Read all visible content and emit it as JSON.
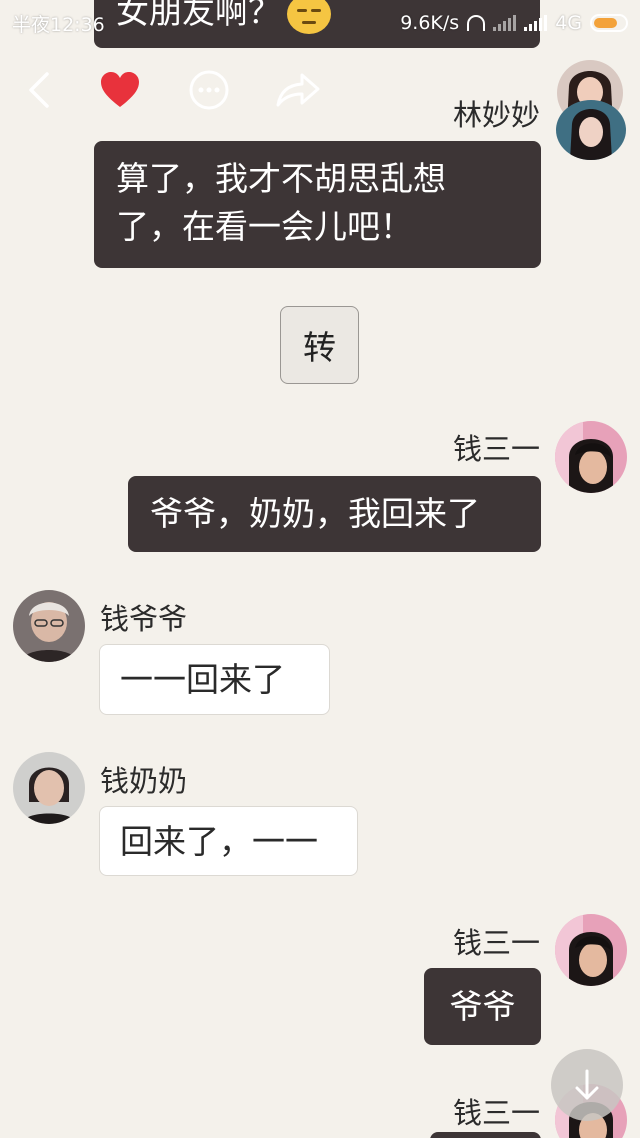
{
  "status_bar": {
    "time": "半夜12:36",
    "speed": "9.6K/s",
    "network": "4G",
    "network_sub": "ıl",
    "battery_level": 0.78,
    "accent_color": "#f3a23a"
  },
  "toolbar": {
    "icons": [
      "back-icon",
      "heart-icon",
      "more-icon",
      "share-icon"
    ],
    "heart_color": "#e8323c"
  },
  "messages": {
    "top_partial": {
      "text": "女朋友啊？",
      "emoji": "unamused-face"
    },
    "lin": {
      "name": "林妙妙",
      "line1": "算了，我才不胡思乱想",
      "line2": "了，在看一会儿吧！"
    },
    "transfer": {
      "label": "转"
    },
    "qian1": {
      "name": "钱三一",
      "text": "爷爷，奶奶，我回来了"
    },
    "grandpa": {
      "name": "钱爷爷",
      "text": "一一回来了"
    },
    "grandma": {
      "name": "钱奶奶",
      "text": "回来了，一一"
    },
    "qian2": {
      "name": "钱三一",
      "text": "爷爷"
    },
    "qian3": {
      "name": "钱三一"
    }
  },
  "colors": {
    "background": "#f4f1eb",
    "dark_bubble": "#3d3536",
    "light_bubble": "#ffffff"
  }
}
